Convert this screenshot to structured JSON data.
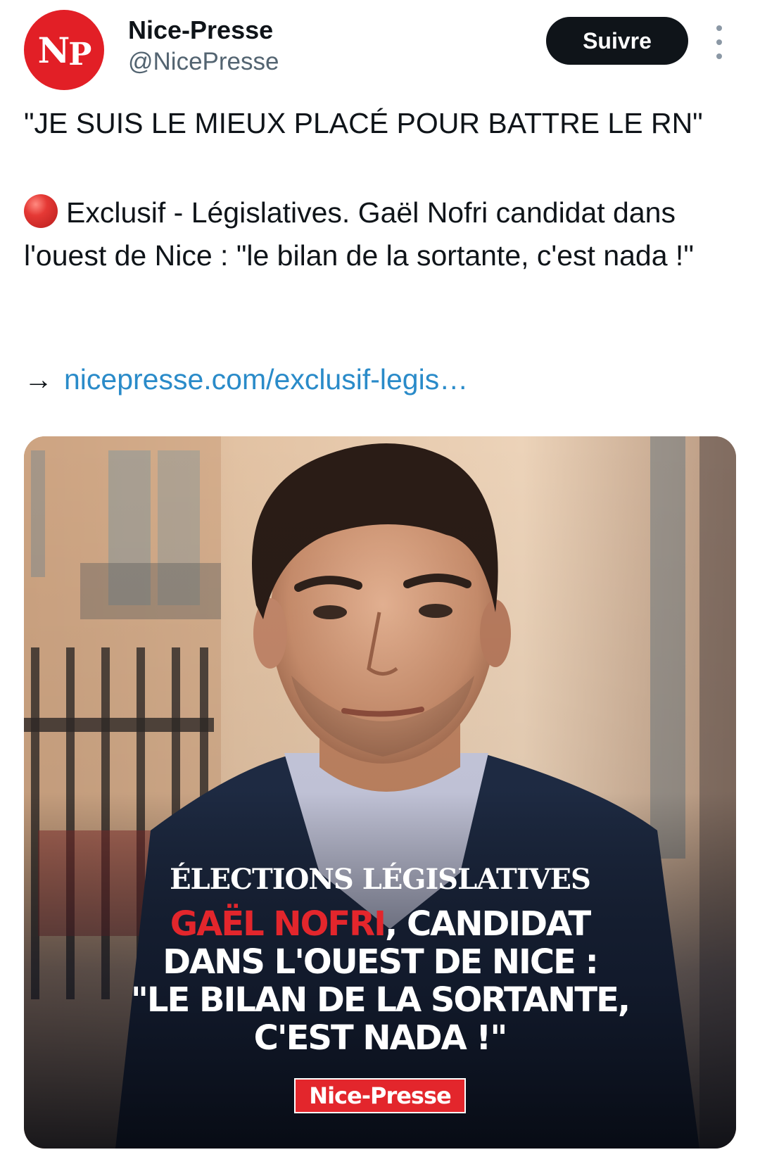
{
  "account": {
    "avatar_text_n": "N",
    "avatar_text_p": "P",
    "name": "Nice-Presse",
    "handle": "@NicePresse",
    "follow_label": "Suivre",
    "avatar_color": "#e21f26"
  },
  "post": {
    "headline": "\"JE SUIS LE MIEUX PLACÉ POUR BATTRE LE RN\"",
    "body": "Exclusif - Législatives. Gaël Nofri candidat dans l'ouest de Nice : \"le bilan de la sortante, c'est nada !\"",
    "link_arrow": "→",
    "link_text": "nicepresse.com/exclusif-legis…",
    "link_color": "#2a8bc9"
  },
  "media": {
    "kicker": "ÉLECTIONS LÉGISLATIVES",
    "line1_red": "GAËL NOFRI",
    "line1_rest": ", CANDIDAT",
    "line2": "DANS L'OUEST DE NICE :",
    "line3": "\"LE BILAN DE LA SORTANTE,",
    "line4": "C'EST NADA !\"",
    "brand": "Nice-Presse",
    "accent_red": "#e3262c"
  }
}
